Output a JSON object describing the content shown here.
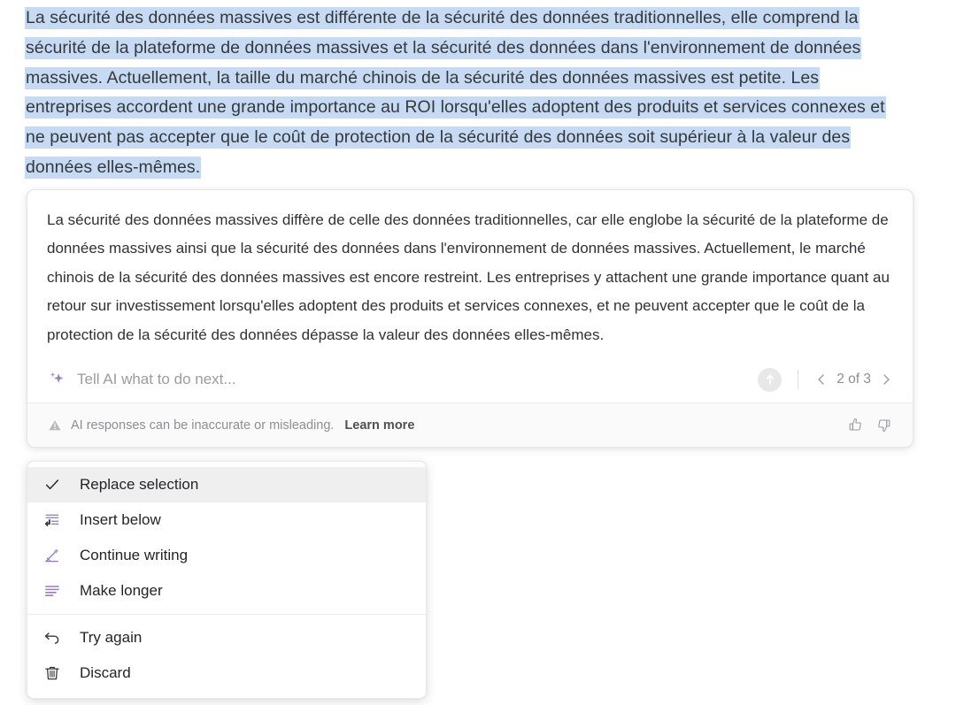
{
  "document": {
    "selected_text": "La sécurité des données massives est différente de la sécurité des données traditionnelles, elle comprend la sécurité de la plateforme de données massives et la sécurité des données dans l'environnement de données massives. Actuellement, la taille du marché chinois de la sécurité des données massives est petite. Les entreprises accordent une grande importance au ROI lorsqu'elles adoptent des produits et services connexes et ne peuvent pas accepter que le coût de protection de la sécurité des données soit supérieur à la valeur des données elles-mêmes.",
    "selection_color": "#c6dbf3"
  },
  "ai_card": {
    "response_text": "La sécurité des données massives diffère de celle des données traditionnelles, car elle englobe la sécurité de la plateforme de données massives ainsi que la sécurité des données dans l'environnement de données massives. Actuellement, le marché chinois de la sécurité des données massives est encore restreint. Les entreprises y attachent une grande importance quant au retour sur investissement lorsqu'elles adoptent des produits et services connexes, et ne peuvent accepter que le coût de la protection de la sécurité des données dépasse la valeur des données elles-mêmes.",
    "prompt": {
      "icon": "sparkle-icon",
      "placeholder": "Tell AI what to do next...",
      "value": "",
      "send_icon": "arrow-up-circle-icon"
    },
    "pager": {
      "prev_icon": "chevron-left-icon",
      "label": "2 of 3",
      "current": 2,
      "total": 3,
      "next_icon": "chevron-right-icon"
    },
    "footer": {
      "warning_icon": "warning-triangle-icon",
      "disclaimer": "AI responses can be inaccurate or misleading.",
      "learn_more": "Learn more",
      "thumbs_up_icon": "thumbs-up-icon",
      "thumbs_down_icon": "thumbs-down-icon"
    }
  },
  "menu": {
    "accent_color": "#9b7bc4",
    "groups": [
      {
        "items": [
          {
            "label": "Replace selection",
            "icon": "check-icon",
            "active": true
          },
          {
            "label": "Insert below",
            "icon": "insert-below-icon",
            "active": false
          },
          {
            "label": "Continue writing",
            "icon": "pencil-icon",
            "active": false
          },
          {
            "label": "Make longer",
            "icon": "make-longer-icon",
            "active": false
          }
        ]
      },
      {
        "items": [
          {
            "label": "Try again",
            "icon": "undo-arrow-icon",
            "active": false
          },
          {
            "label": "Discard",
            "icon": "trash-icon",
            "active": false
          }
        ]
      }
    ]
  }
}
